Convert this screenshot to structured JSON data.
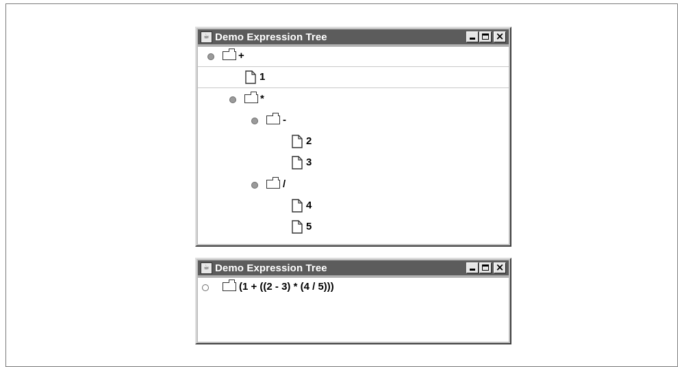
{
  "tree_window": {
    "title": "Demo Expression Tree",
    "nodes": [
      {
        "label": "+",
        "kind": "folder",
        "expanded": true
      },
      {
        "label": "1",
        "kind": "leaf"
      },
      {
        "label": "*",
        "kind": "folder",
        "expanded": true
      },
      {
        "label": "-",
        "kind": "folder",
        "expanded": true
      },
      {
        "label": "2",
        "kind": "leaf"
      },
      {
        "label": "3",
        "kind": "leaf"
      },
      {
        "label": "/",
        "kind": "folder",
        "expanded": true
      },
      {
        "label": "4",
        "kind": "leaf"
      },
      {
        "label": "5",
        "kind": "leaf"
      }
    ]
  },
  "collapsed_window": {
    "title": "Demo Expression Tree",
    "node": {
      "label": "(1 + ((2 - 3) * (4 / 5)))",
      "kind": "folder",
      "expanded": false
    }
  },
  "icons": {
    "app": "java-cup-icon",
    "minimize": "minimize-icon",
    "maximize": "maximize-icon",
    "close": "close-icon",
    "folder": "folder-icon",
    "leaf": "document-icon",
    "expand_handle": "tree-handle-icon"
  },
  "colors": {
    "titlebar": "#5c5c5c",
    "window_chrome": "#c0c0c0",
    "content_bg": "#ffffff",
    "handle_fill": "#9a9a9a"
  }
}
